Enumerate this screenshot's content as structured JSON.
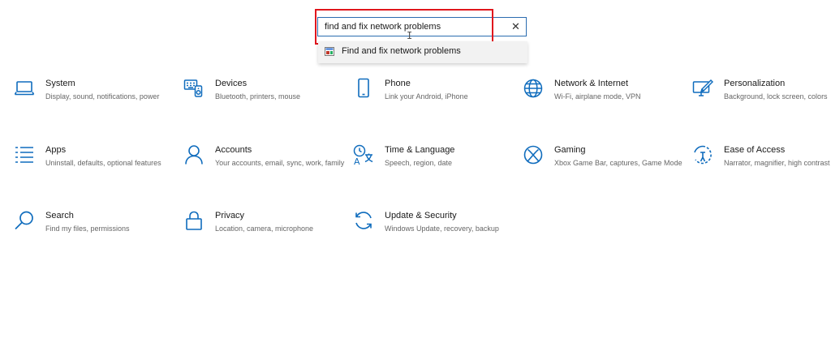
{
  "search": {
    "value": "find and fix network problems",
    "clear_icon": "close-icon"
  },
  "suggestions": [
    {
      "label": "Find and fix network problems",
      "icon": "troubleshoot-icon"
    }
  ],
  "colors": {
    "accent": "#0f6cbd",
    "highlight_border": "#e0161d",
    "title_text": "#1a1a1a",
    "desc_text": "#666666"
  },
  "categories": [
    {
      "title": "System",
      "desc": "Display, sound, notifications, power",
      "icon": "laptop-icon"
    },
    {
      "title": "Devices",
      "desc": "Bluetooth, printers, mouse",
      "icon": "devices-icon"
    },
    {
      "title": "Phone",
      "desc": "Link your Android, iPhone",
      "icon": "phone-icon"
    },
    {
      "title": "Network & Internet",
      "desc": "Wi-Fi, airplane mode, VPN",
      "icon": "globe-icon"
    },
    {
      "title": "Personalization",
      "desc": "Background, lock screen, colors",
      "icon": "personalization-icon"
    },
    {
      "title": "Apps",
      "desc": "Uninstall, defaults, optional features",
      "icon": "apps-list-icon"
    },
    {
      "title": "Accounts",
      "desc": "Your accounts, email, sync, work, family",
      "icon": "person-icon"
    },
    {
      "title": "Time & Language",
      "desc": "Speech, region, date",
      "icon": "time-language-icon"
    },
    {
      "title": "Gaming",
      "desc": "Xbox Game Bar, captures, Game Mode",
      "icon": "xbox-icon"
    },
    {
      "title": "Ease of Access",
      "desc": "Narrator, magnifier, high contrast",
      "icon": "ease-of-access-icon"
    },
    {
      "title": "Search",
      "desc": "Find my files, permissions",
      "icon": "search-icon"
    },
    {
      "title": "Privacy",
      "desc": "Location, camera, microphone",
      "icon": "lock-icon"
    },
    {
      "title": "Update & Security",
      "desc": "Windows Update, recovery, backup",
      "icon": "sync-icon"
    }
  ]
}
